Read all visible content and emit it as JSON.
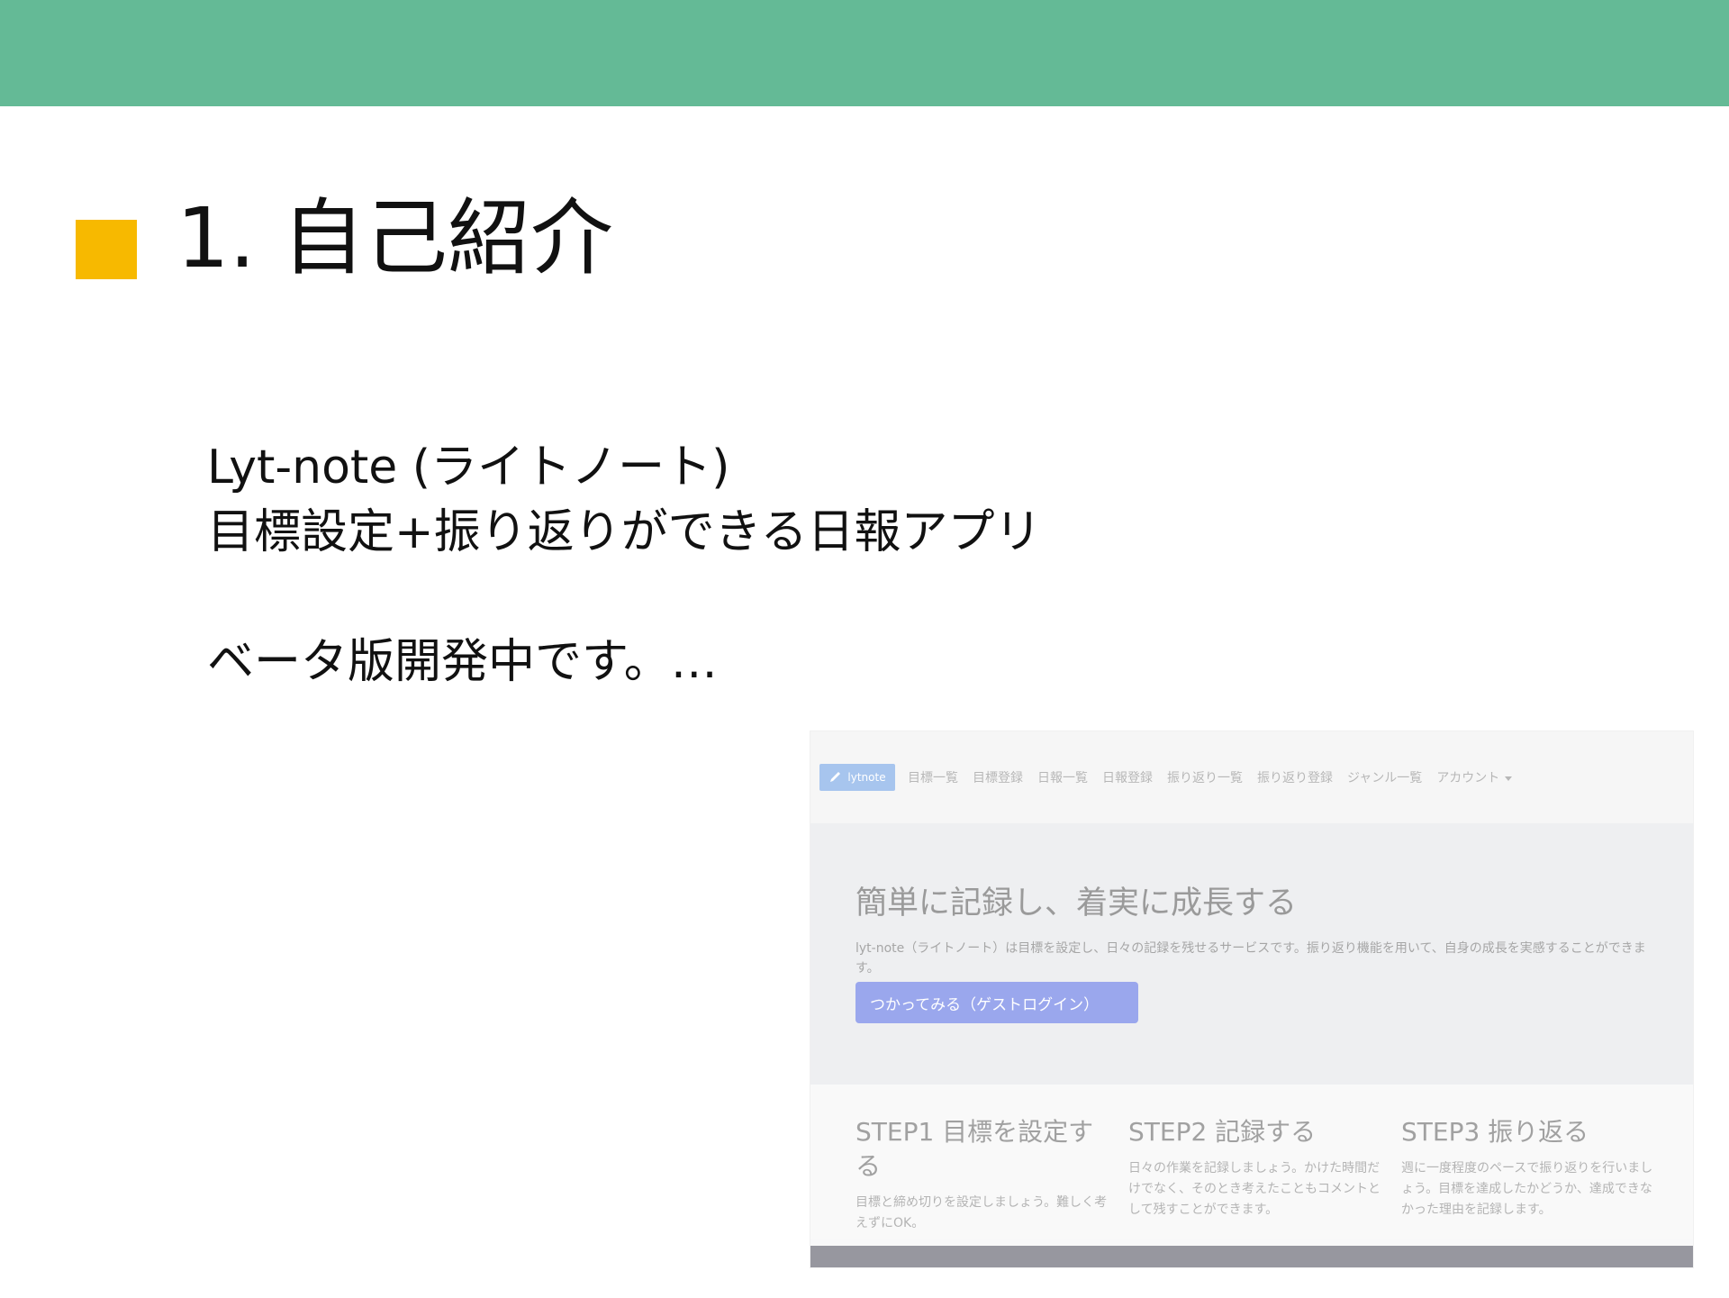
{
  "slide": {
    "title": "1. 自己紹介",
    "body_lines": [
      "Lyt-note (ライトノート)",
      "目標設定+振り返りができる日報アプリ",
      "",
      "ベータ版開発中です。…"
    ]
  },
  "screenshot": {
    "brand": "lytnote",
    "nav_items": [
      "目標一覧",
      "目標登録",
      "日報一覧",
      "日報登録",
      "振り返り一覧",
      "振り返り登録",
      "ジャンル一覧"
    ],
    "account_menu": "アカウント",
    "hero": {
      "title": "簡単に記録し、着実に成長する",
      "description": "lyt-note（ライトノート）は目標を設定し、日々の記録を残せるサービスです。振り返り機能を用いて、自身の成長を実感することができます。",
      "button_label": "つかってみる（ゲストログイン）"
    },
    "steps": [
      {
        "title": "STEP1 目標を設定する",
        "description": "目標と締め切りを設定しましょう。難しく考えずにOK。"
      },
      {
        "title": "STEP2 記録する",
        "description": "日々の作業を記録しましょう。かけた時間だけでなく、そのとき考えたこともコメントとして残すことができます。"
      },
      {
        "title": "STEP3 振り返る",
        "description": "週に一度程度のペースで振り返りを行いましょう。目標を達成したかどうか、達成できなかった理由を記録します。"
      }
    ]
  },
  "colors": {
    "top_band": "#64ba96",
    "bullet": "#f7b900",
    "button": "#9aa7ed"
  }
}
